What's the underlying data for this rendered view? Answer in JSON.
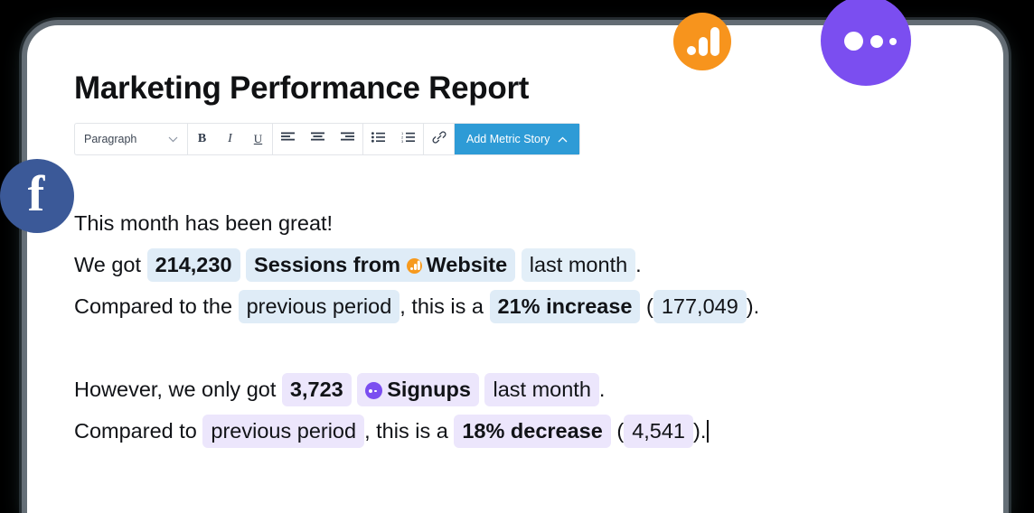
{
  "document": {
    "title": "Marketing Performance Report"
  },
  "toolbar": {
    "style_select": {
      "value": "Paragraph",
      "caret_icon": "chevron-down-icon"
    },
    "bold_label": "B",
    "italic_label": "I",
    "underline_label": "U",
    "align_left_icon": "align-left-icon",
    "align_center_icon": "align-center-icon",
    "align_right_icon": "align-right-icon",
    "bullet_list_icon": "bullet-list-icon",
    "numbered_list_icon": "numbered-list-icon",
    "link_icon": "link-icon",
    "add_metric_story_label": "Add Metric Story",
    "add_metric_story_caret_icon": "chevron-up-icon",
    "accent_color": "#2e9bd6"
  },
  "content": {
    "paragraph_1": {
      "line_1": "This month has been great!",
      "line_2": {
        "lead": "We got",
        "metric_value": "214,230",
        "metric_name": "Sessions from",
        "source_name": "Website",
        "source_icon": "google-analytics-icon",
        "period": "last month",
        "punct": "."
      },
      "line_3": {
        "lead": "Compared to the",
        "comparison": "previous period",
        "mid_1": ", this is a",
        "change": "21% increase",
        "paren_open": "(",
        "previous_value": "177,049",
        "paren_close": ")."
      }
    },
    "paragraph_2": {
      "line_1": {
        "lead": "However, we only got",
        "metric_value": "3,723",
        "metric_name": "Signups",
        "source_icon": "intercom-icon",
        "period": "last month",
        "punct": "."
      },
      "line_2": {
        "lead": "Compared to",
        "comparison": "previous period",
        "mid_1": ", this is a",
        "change": "18% decrease",
        "paren_open": "(",
        "previous_value": "4,541",
        "paren_close": ")."
      }
    }
  },
  "badges": {
    "facebook": {
      "icon": "facebook-icon",
      "glyph": "f",
      "color": "#3b5998"
    },
    "analytics": {
      "icon": "google-analytics-icon",
      "color": "#f7941d"
    },
    "intercom": {
      "icon": "intercom-icon",
      "color": "#7b4ef0"
    }
  },
  "pill_colors": {
    "blue": "#dfecf7",
    "purple": "#ece6fc"
  }
}
